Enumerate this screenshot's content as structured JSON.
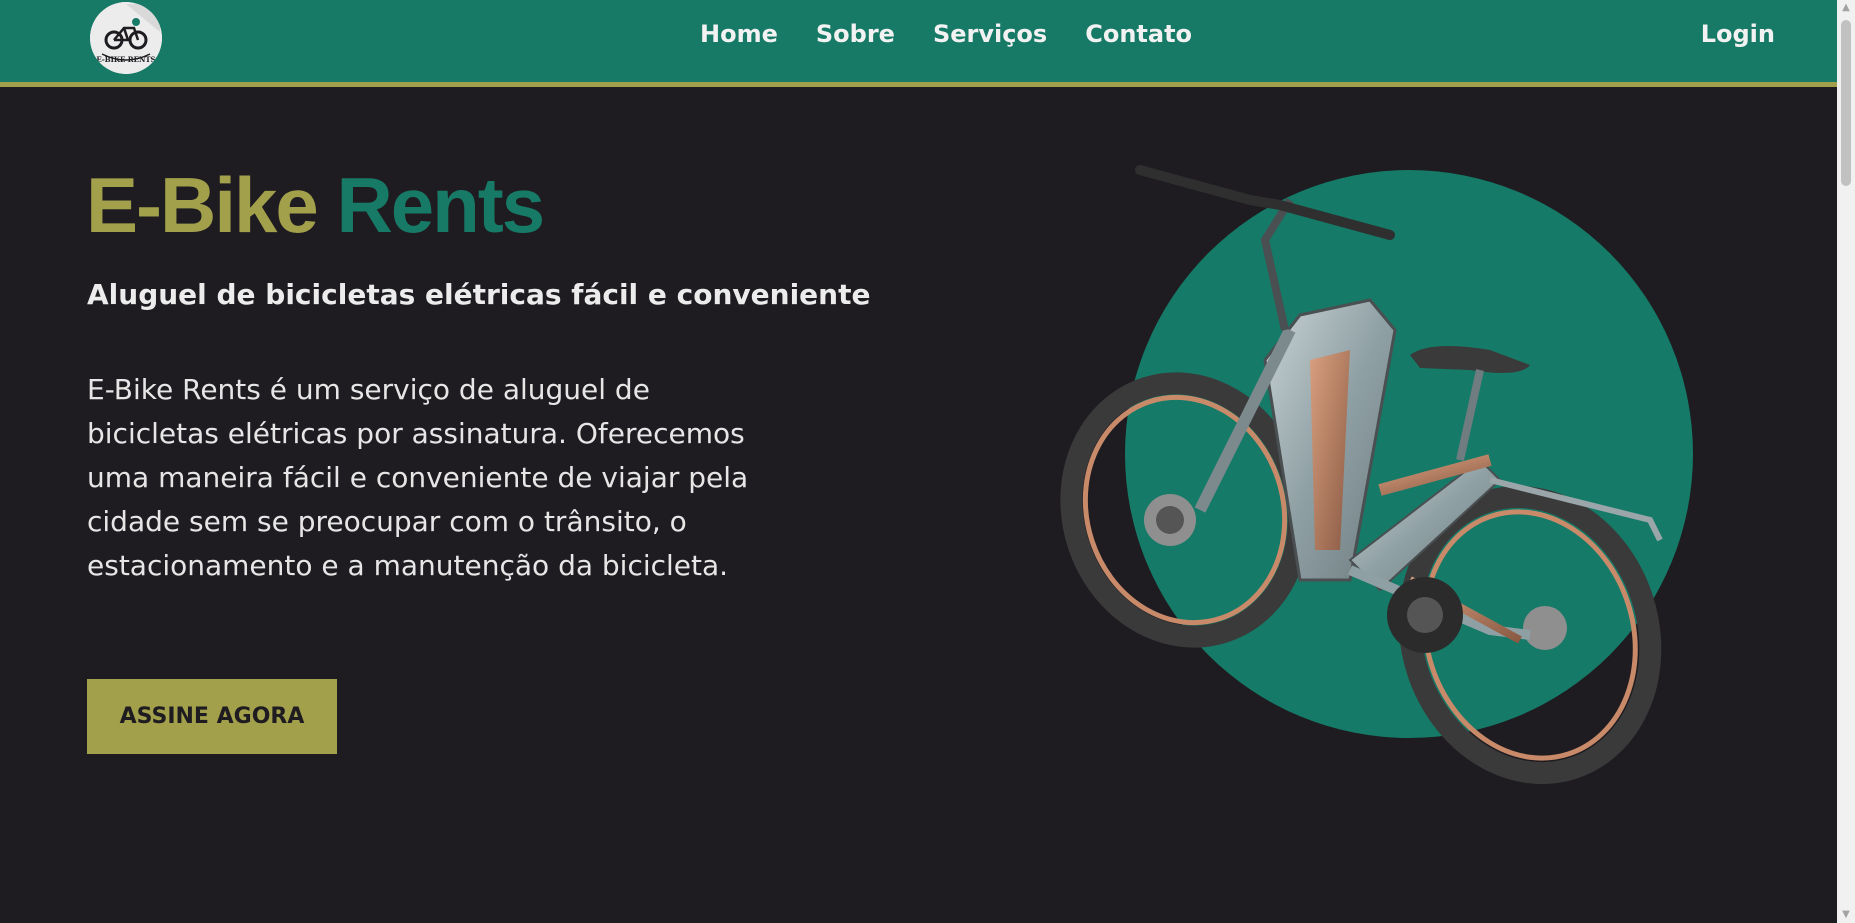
{
  "nav": {
    "logo_alt": "E-BIKE RENTS",
    "links": [
      "Home",
      "Sobre",
      "Serviços",
      "Contato"
    ],
    "login": "Login"
  },
  "hero": {
    "title_part1": "E-Bike",
    "title_part2": "Rents",
    "subtitle": "Aluguel de bicicletas elétricas fácil e conveniente",
    "description": "E-Bike Rents é um serviço de aluguel de bicicletas elétricas por assinatura. Oferecemos uma maneira fácil e conveniente de viajar pela cidade sem se preocupar com o trânsito, o estacionamento e a manutenção da bicicleta.",
    "cta": "ASSINE AGORA"
  },
  "colors": {
    "nav_bg": "#177a67",
    "accent_olive": "#a3a04c",
    "accent_green": "#177a67",
    "page_bg": "#1e1c20"
  },
  "icons": [
    "bike-logo-icon",
    "e-bike-image",
    "scroll-up-icon",
    "scroll-down-icon"
  ]
}
